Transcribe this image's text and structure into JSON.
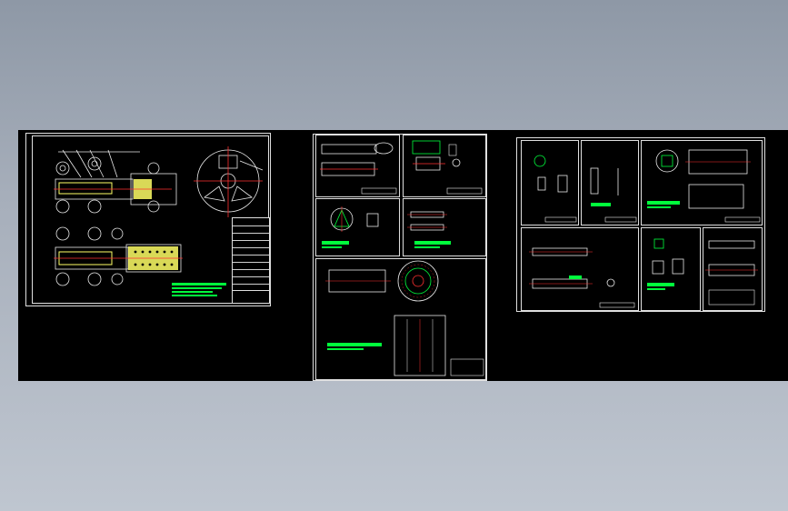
{
  "viewport": {
    "background": "gradient-gray-blue"
  },
  "canvas": {
    "background_color": "#000000"
  },
  "colors": {
    "frame": "#e8e8e8",
    "green": "#00ff3c",
    "yellow": "#ffff66",
    "red": "#ff3030",
    "cyan": "#38e8ff",
    "magenta": "#ff4cff"
  },
  "sheets": [
    {
      "id": "assembly-drawing",
      "kind": "assembly",
      "subviews": 1
    },
    {
      "id": "part-drawings-set-a",
      "kind": "parts",
      "subviews": 5
    },
    {
      "id": "part-drawings-set-b",
      "kind": "parts",
      "subviews": 6
    }
  ]
}
